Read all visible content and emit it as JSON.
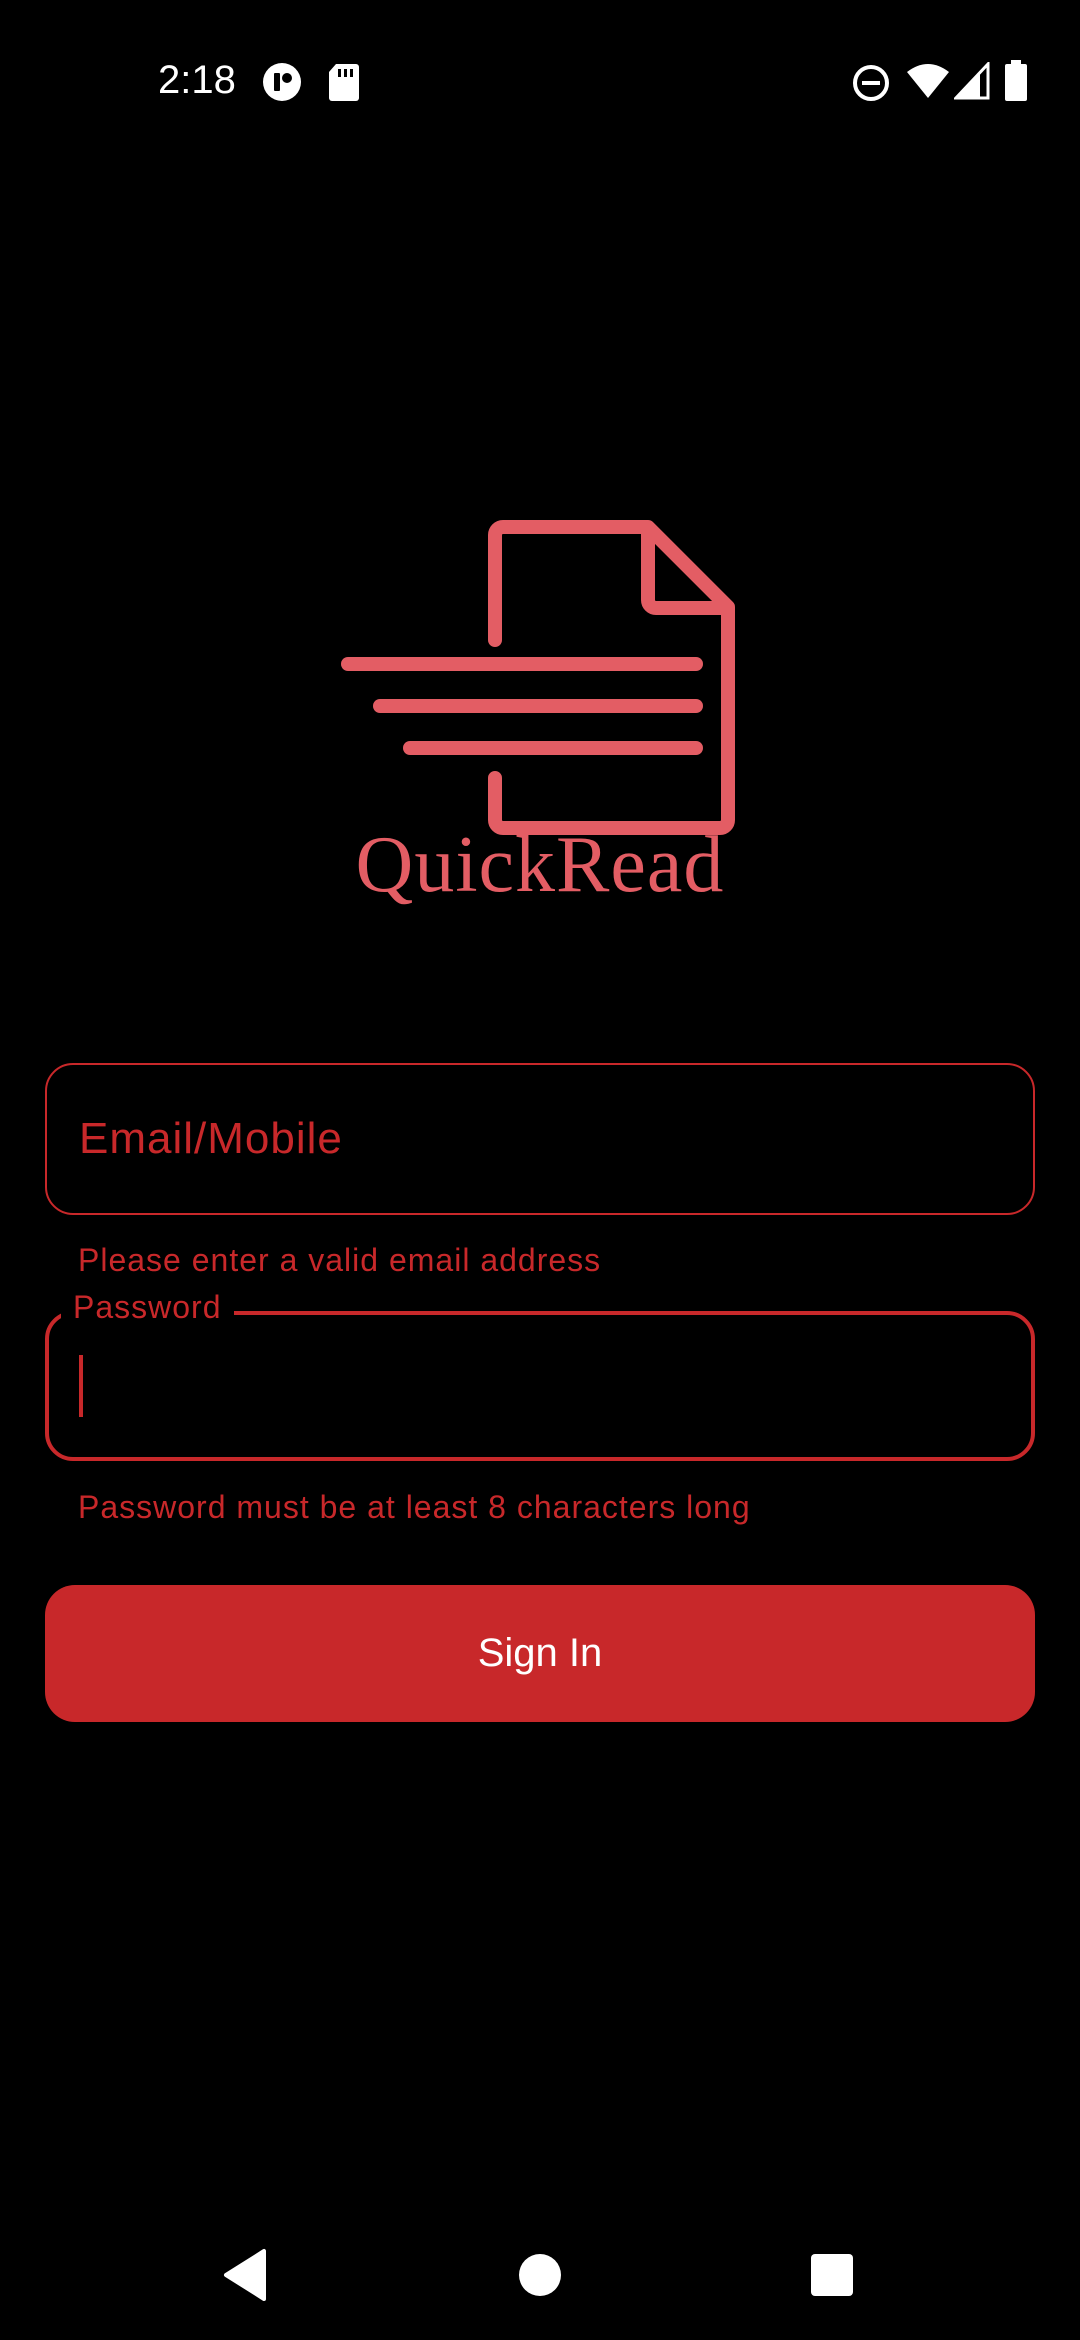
{
  "status_bar": {
    "time": "2:18",
    "icons": [
      "notification-app-icon",
      "sd-card-icon",
      "do-not-disturb-icon",
      "wifi-icon",
      "cell-signal-icon",
      "battery-icon"
    ]
  },
  "logo": {
    "icon": "document-icon",
    "text": "QuickRead",
    "color": "#e35d64"
  },
  "form": {
    "email": {
      "placeholder": "Email/Mobile",
      "value": "",
      "error": "Please enter a valid email address"
    },
    "password": {
      "label": "Password",
      "value": "",
      "error": "Password must be at least 8 characters long"
    },
    "submit_label": "Sign In"
  },
  "nav": {
    "back": "back-icon",
    "home": "home-icon",
    "recents": "recents-icon"
  },
  "colors": {
    "accent": "#c8282a",
    "background": "#000000",
    "logo": "#e35d64"
  }
}
